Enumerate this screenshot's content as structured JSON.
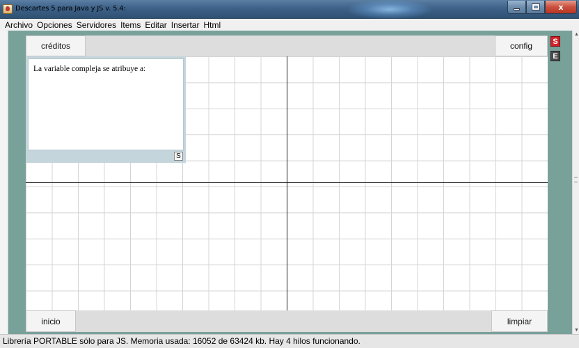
{
  "window": {
    "title": "Descartes 5 para Java y JS v. 5.4:",
    "icon": "java-coffee-icon",
    "controls": [
      "minimize-icon",
      "maximize-icon",
      "close-icon"
    ],
    "close_label": "x"
  },
  "menu": {
    "items": [
      "Archivo",
      "Opciones",
      "Servidores",
      "Items",
      "Editar",
      "Insertar",
      "Html"
    ]
  },
  "toolbar_top": {
    "creditos_label": "créditos",
    "config_label": "config"
  },
  "side_badges": {
    "s_label": "S",
    "e_label": "E"
  },
  "panel": {
    "text": "La variable compleja se atribuye a:",
    "s_button": "S"
  },
  "toolbar_bottom": {
    "inicio_label": "inicio",
    "limpiar_label": "limpiar"
  },
  "status": {
    "text": "Librería PORTABLE sólo para JS. Memoria usada: 16052 de 63424 kb. Hay 4 hilos funcionando."
  },
  "colors": {
    "app_background": "#78a19a",
    "badge_s": "#d42027",
    "badge_e": "#4a4a4a",
    "panel_frame": "#c5d5dc"
  }
}
